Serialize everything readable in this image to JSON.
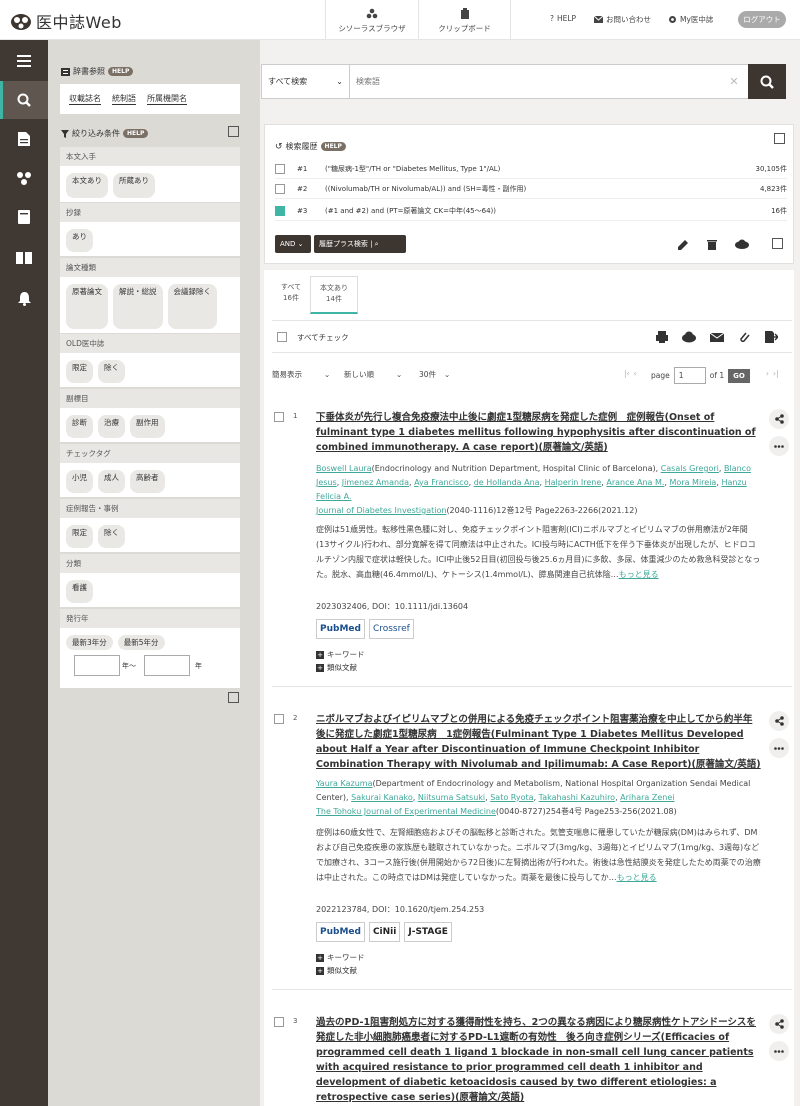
{
  "header": {
    "brand": "医中誌Web",
    "thesaurus_label": "シソーラスブラウザ",
    "clipboard_label": "クリップボード",
    "help_label": "HELP",
    "contact_label": "お問い合わせ",
    "my_label": "My医中誌",
    "logout_label": "ログアウト"
  },
  "dictionary": {
    "title": "辞書参照",
    "help": "HELP",
    "links": [
      "収載誌名",
      "統制語",
      "所属機関名"
    ]
  },
  "filters": {
    "title": "絞り込み条件",
    "help": "HELP",
    "sections": [
      {
        "title": "本文入手",
        "chips": [
          "本文あり",
          "所蔵あり"
        ]
      },
      {
        "title": "抄録",
        "chips": [
          "あり"
        ]
      },
      {
        "title": "論文種類",
        "chips": [
          "原著論文",
          "解説・総説",
          "会議録除く"
        ]
      },
      {
        "title": "OLD医中誌",
        "chips": [
          "限定",
          "除く"
        ]
      },
      {
        "title": "副標目",
        "chips": [
          "診断",
          "治療",
          "副作用"
        ]
      },
      {
        "title": "チェックタグ",
        "chips": [
          "小児",
          "成人",
          "高齢者"
        ]
      },
      {
        "title": "症例報告・事例",
        "chips": [
          "限定",
          "除く"
        ]
      },
      {
        "title": "分類",
        "chips": [
          "看護"
        ]
      },
      {
        "title": "発行年",
        "chips": [
          "最新3年分",
          "最新5年分"
        ]
      }
    ],
    "year_from_suffix": "年〜",
    "year_to_suffix": "年"
  },
  "search": {
    "scope": "すべて検索",
    "placeholder": "検索語"
  },
  "history": {
    "title": "検索履歴",
    "help": "HELP",
    "rows": [
      {
        "num": "#1",
        "query": "(\"糖尿病-1型\"/TH or \"Diabetes Mellitus, Type 1\"/AL)",
        "count": "30,105件",
        "checked": false
      },
      {
        "num": "#2",
        "query": "((Nivolumab/TH or Nivolumab/AL)) and (SH=毒性・副作用)",
        "count": "4,823件",
        "checked": false
      },
      {
        "num": "#3",
        "query": "(#1 and #2) and (PT=原著論文 CK=中年(45〜64))",
        "count": "16件",
        "checked": true
      }
    ],
    "and_label": "AND",
    "plus_label": "履歴プラス検索"
  },
  "tabs": [
    {
      "label": "すべて",
      "count": "16件"
    },
    {
      "label": "本文あり",
      "count": "14件"
    }
  ],
  "toolbar": {
    "check_all": "すべてチェック",
    "display": "簡易表示",
    "sort": "新しい順",
    "per_page": "30件",
    "page_label": "page",
    "page_value": "1",
    "of_label": "of 1",
    "go": "GO"
  },
  "results": [
    {
      "num": "1",
      "title": "下垂体炎が先行し複合免疫療法中止後に劇症1型糖尿病を発症した症例　症例報告(Onset of fulminant type 1 diabetes mellitus following hypophysitis after discontinuation of combined immunotherapy. A case report)(原著論文/英語)",
      "authors": [
        {
          "name": "Boswell Laura",
          "aff": "(Endocrinology and Nutrition Department, Hospital Clinic of Barcelona), "
        },
        {
          "name": "Casals Gregori",
          "aff": ", "
        },
        {
          "name": "Blanco Jesus",
          "aff": ", "
        },
        {
          "name": "Jimenez Amanda",
          "aff": ", "
        },
        {
          "name": "Aya Francisco",
          "aff": ", "
        },
        {
          "name": "de Hollanda Ana",
          "aff": ", "
        },
        {
          "name": "Halperin Irene",
          "aff": ", "
        },
        {
          "name": "Arance Ana M.",
          "aff": ", "
        },
        {
          "name": "Mora Mireia",
          "aff": ", "
        },
        {
          "name": "Hanzu Felicia A.",
          "aff": ""
        }
      ],
      "journal": "Journal of Diabetes Investigation",
      "journal_info": "(2040-1116)12巻12号 Page2263-2266(2021.12)",
      "abstract": "症例は51歳男性。転移性黒色腫に対し、免疫チェックポイント阻害剤(ICI)ニボルマブとイピリムマブの併用療法が2年間(13サイクル)行われ、部分寛解を得て同療法は中止された。ICI投与時にACTH低下を伴う下垂体炎が出現したが、ヒドロコルチゾン内服で症状は軽快した。ICI中止後52日目(初回投与後25.6ヵ月目)に多飲、多尿、体重減少のため救急科受診となった。脱水、高血糖(46.4mmol/L)、ケトーシス(1.4mmol/L)、膵島関連自己抗体陰…",
      "more": "もっと見る",
      "doi": "2023032406, DOI：10.1111/jdi.13604",
      "logos": [
        "PubMed",
        "Crossref"
      ],
      "keyword_label": "キーワード",
      "similar_label": "類似文献"
    },
    {
      "num": "2",
      "title": "ニボルマブおよびイピリムマブとの併用による免疫チェックポイント阻害薬治療を中止してから約半年後に発症した劇症1型糖尿病　1症例報告(Fulminant Type 1 Diabetes Mellitus Developed about Half a Year after Discontinuation of Immune Checkpoint Inhibitor Combination Therapy with Nivolumab and Ipilimumab: A Case Report)(原著論文/英語)",
      "authors": [
        {
          "name": "Yaura Kazuma",
          "aff": "(Department of Endocrinology and Metabolism, National Hospital Organization Sendai Medical Center), "
        },
        {
          "name": "Sakurai Kanako",
          "aff": ", "
        },
        {
          "name": "Niitsuma Satsuki",
          "aff": ", "
        },
        {
          "name": "Sato Ryota",
          "aff": ", "
        },
        {
          "name": "Takahashi Kazuhiro",
          "aff": ", "
        },
        {
          "name": "Arihara Zenei",
          "aff": ""
        }
      ],
      "journal": "The Tohoku Journal of Experimental Medicine",
      "journal_info": "(0040-8727)254巻4号 Page253-256(2021.08)",
      "abstract": "症例は60歳女性で、左腎細胞癌およびその脳転移と診断された。気管支喘息に罹患していたが糖尿病(DM)はみられず、DMおよび自己免疫疾患の家族歴も聴取されていなかった。ニボルマブ(3mg/kg、3週毎)とイピリムマブ(1mg/kg、3週毎)などで加療され、3コース施行後(併用開始から72日後)に左腎摘出術が行われた。術後は急性結膜炎を発症したため両薬での治療は中止された。この時点ではDMは発症していなかった。両薬を最後に投与してか…",
      "more": "もっと見る",
      "doi": "2022123784, DOI：10.1620/tjem.254.253",
      "logos": [
        "PubMed",
        "CiNii",
        "J-STAGE"
      ],
      "keyword_label": "キーワード",
      "similar_label": "類似文献"
    },
    {
      "num": "3",
      "title": "過去のPD-1阻害剤処方に対する獲得耐性を持ち、2つの異なる病因により糖尿病性ケトアシドーシスを発症した非小細胞肺癌患者に対するPD-L1遮断の有効性　後ろ向き症例シリーズ(Efficacies of programmed cell death 1 ligand 1 blockade in non-small cell lung cancer patients with acquired resistance to prior programmed cell death 1 inhibitor and development of diabetic ketoacidosis caused by two different etiologies: a retrospective case series)(原著論文/英語)"
    }
  ]
}
